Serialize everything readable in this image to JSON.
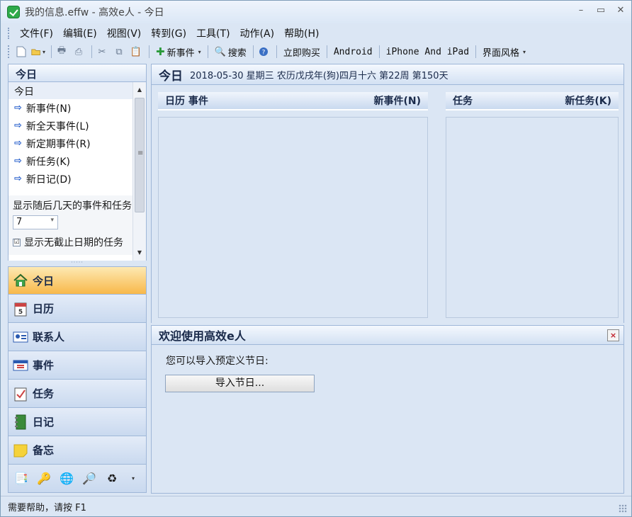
{
  "window": {
    "title": "我的信息.effw - 高效e人 - 今日"
  },
  "menu": [
    "文件(F)",
    "编辑(E)",
    "视图(V)",
    "转到(G)",
    "工具(T)",
    "动作(A)",
    "帮助(H)"
  ],
  "toolbar": {
    "new_event": "新事件",
    "search": "搜索",
    "buy_now": "立即购买",
    "android": "Android",
    "iphone_ipad": "iPhone And iPad",
    "skin": "界面风格"
  },
  "left_panel": {
    "header": "今日",
    "today_item": "今日",
    "links": [
      "新事件(N)",
      "新全天事件(L)",
      "新定期事件(R)",
      "新任务(K)",
      "新日记(D)"
    ],
    "days_label": "显示随后几天的事件和任务",
    "days_value": "7",
    "show_undated_label": "显示无截止日期的任务",
    "show_undated_checked": "☑"
  },
  "nav": [
    {
      "label": "今日",
      "icon": "home-icon",
      "active": true
    },
    {
      "label": "日历",
      "icon": "calendar-icon"
    },
    {
      "label": "联系人",
      "icon": "contacts-icon"
    },
    {
      "label": "事件",
      "icon": "events-icon"
    },
    {
      "label": "任务",
      "icon": "tasks-icon"
    },
    {
      "label": "日记",
      "icon": "diary-icon"
    },
    {
      "label": "备忘",
      "icon": "memo-icon"
    }
  ],
  "main": {
    "title": "今日",
    "date_info": "2018-05-30 星期三 农历戊戌年(狗)四月十六 第22周 第150天",
    "calendar_section": {
      "title": "日历 事件",
      "action": "新事件(N)"
    },
    "task_section": {
      "title": "任务",
      "action": "新任务(K)"
    }
  },
  "welcome": {
    "title": "欢迎使用高效e人",
    "close": "×",
    "text": "您可以导入预定义节日:",
    "import_button": "导入节日..."
  },
  "status": {
    "text": "需要帮助，请按 F1"
  },
  "colors": {
    "accent": "#1a56c8",
    "active_nav": "#f8b84a",
    "header_bg": "#d3e1f3"
  }
}
